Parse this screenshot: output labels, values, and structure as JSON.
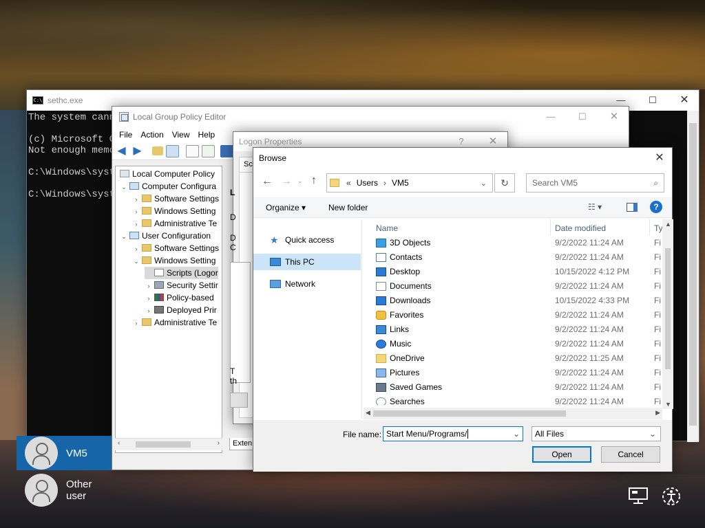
{
  "cmd": {
    "title": "sethc.exe",
    "lines": [
      "The system canno",
      "",
      "(c) Microsoft Co",
      "Not enough memor",
      "",
      "C:\\Windows\\syste",
      "",
      "C:\\Windows\\syste"
    ]
  },
  "gpe": {
    "title": "Local Group Policy Editor",
    "menu": [
      "File",
      "Action",
      "View",
      "Help"
    ],
    "tree": [
      "Local Computer Policy",
      "Computer Configura",
      "Software Settings",
      "Windows Setting",
      "Administrative Te",
      "User Configuration",
      "Software Settings",
      "Windows Setting",
      "Scripts (Logor",
      "Security Settir",
      "Policy-based",
      "Deployed Prir",
      "Administrative Te"
    ],
    "ext_tab": "Exten"
  },
  "logon": {
    "title": "Logon Properties",
    "help_btn": "?",
    "tab": "Scr",
    "frag_l": "L",
    "frag_d1": "D",
    "frag_d2": "D",
    "frag_c": "C",
    "frag_t": "T",
    "frag_th": "th"
  },
  "browse": {
    "title": "Browse",
    "path_prefix": "«",
    "path": [
      "Users",
      "VM5"
    ],
    "search_placeholder": "Search VM5",
    "organize": "Organize ▾",
    "new_folder": "New folder",
    "nav": [
      "Quick access",
      "This PC",
      "Network"
    ],
    "columns": {
      "name": "Name",
      "date": "Date modified",
      "type": "Ty"
    },
    "files": [
      {
        "name": "3D Objects",
        "date": "9/2/2022 11:24 AM",
        "type": "Fi",
        "icon": "3d-objects-icon"
      },
      {
        "name": "Contacts",
        "date": "9/2/2022 11:24 AM",
        "type": "Fi",
        "icon": "contacts-icon"
      },
      {
        "name": "Desktop",
        "date": "10/15/2022 4:12 PM",
        "type": "Fi",
        "icon": "desktop-icon"
      },
      {
        "name": "Documents",
        "date": "9/2/2022 11:24 AM",
        "type": "Fi",
        "icon": "documents-icon"
      },
      {
        "name": "Downloads",
        "date": "10/15/2022 4:33 PM",
        "type": "Fi",
        "icon": "downloads-icon"
      },
      {
        "name": "Favorites",
        "date": "9/2/2022 11:24 AM",
        "type": "Fi",
        "icon": "favorites-icon"
      },
      {
        "name": "Links",
        "date": "9/2/2022 11:24 AM",
        "type": "Fi",
        "icon": "links-icon"
      },
      {
        "name": "Music",
        "date": "9/2/2022 11:24 AM",
        "type": "Fi",
        "icon": "music-icon"
      },
      {
        "name": "OneDrive",
        "date": "9/2/2022 11:25 AM",
        "type": "Fi",
        "icon": "folder-icon"
      },
      {
        "name": "Pictures",
        "date": "9/2/2022 11:24 AM",
        "type": "Fi",
        "icon": "pictures-icon"
      },
      {
        "name": "Saved Games",
        "date": "9/2/2022 11:24 AM",
        "type": "Fi",
        "icon": "saved-games-icon"
      },
      {
        "name": "Searches",
        "date": "9/2/2022 11:24 AM",
        "type": "Fi",
        "icon": "searches-icon"
      }
    ],
    "file_name_label": "File name:",
    "file_name_value": "Start Menu/Programs/",
    "file_type": "All Files",
    "open": "Open",
    "cancel": "Cancel"
  },
  "users": [
    {
      "name": "VM5"
    },
    {
      "name": "Other user"
    }
  ],
  "colors": {
    "accent": "#0078d7",
    "selected_user_bg": "#1565a8",
    "nav_selected": "#cce4f7"
  }
}
